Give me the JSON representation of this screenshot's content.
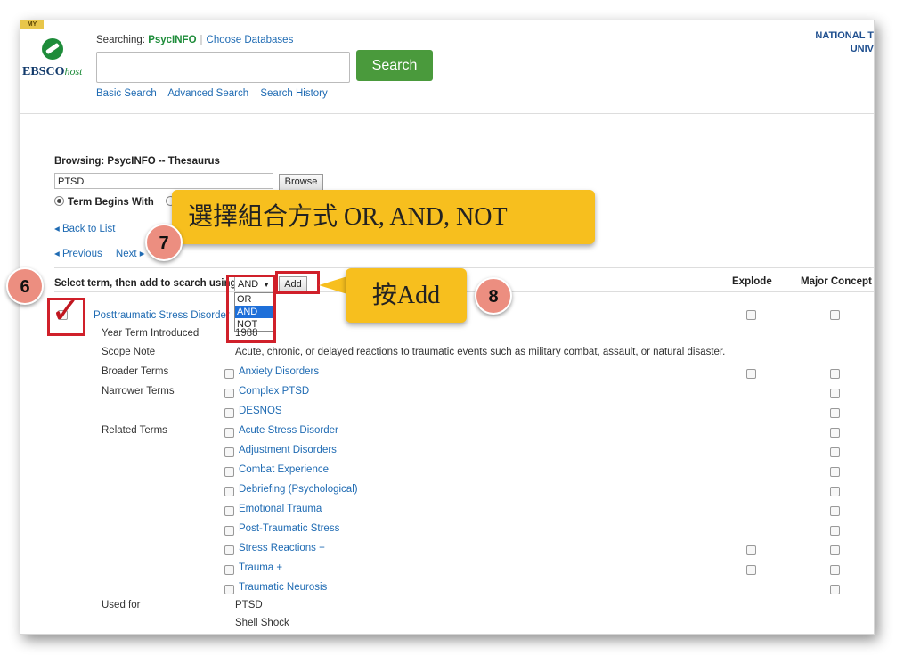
{
  "header": {
    "badge": "MY",
    "logo_main": "EBSCO",
    "logo_sub": "host",
    "searching_prefix": "Searching: ",
    "database": "PsycINFO",
    "choose_databases": "Choose Databases",
    "search_button": "Search",
    "nav": [
      "Basic Search",
      "Advanced Search",
      "Search History"
    ],
    "institution_line1": "NATIONAL T",
    "institution_line2": "UNIV"
  },
  "browse": {
    "title": "Browsing: PsycINFO -- Thesaurus",
    "input_value": "PTSD",
    "browse_button": "Browse",
    "radio_label": "Term Begins With",
    "radio_other": "T",
    "back_to_list": "◂ Back to List",
    "previous": "◂ Previous",
    "next": "Next ▸"
  },
  "select_bar": {
    "label": "Select term, then add to search using:",
    "operator_selected": "AND",
    "operator_arrow": "▼",
    "options": [
      "OR",
      "AND",
      "NOT"
    ],
    "add_button": "Add",
    "col_explode": "Explode",
    "col_major": "Major Concept"
  },
  "term": {
    "title": "Posttraumatic Stress Disorder",
    "year_label": "Year Term Introduced",
    "year_value": "1988",
    "scope_label": "Scope Note",
    "scope_value": "Acute, chronic, or delayed reactions to traumatic events such as military combat, assault, or natural disaster.",
    "broader_label": "Broader Terms",
    "broader": [
      "Anxiety Disorders"
    ],
    "narrower_label": "Narrower Terms",
    "narrower": [
      "Complex PTSD",
      "DESNOS"
    ],
    "related_label": "Related Terms",
    "related": [
      "Acute Stress Disorder",
      "Adjustment Disorders",
      "Combat Experience",
      "Debriefing (Psychological)",
      "Emotional Trauma",
      "Post-Traumatic Stress",
      "Stress Reactions +",
      "Trauma +",
      "Traumatic Neurosis"
    ],
    "used_for_label": "Used for",
    "used_for": [
      "PTSD",
      "Shell Shock"
    ]
  },
  "annotations": {
    "step6": "6",
    "step7": "7",
    "step8": "8",
    "callout7": "選擇組合方式 OR, AND, NOT",
    "callout8": "按Add",
    "checkmark": "✓"
  }
}
